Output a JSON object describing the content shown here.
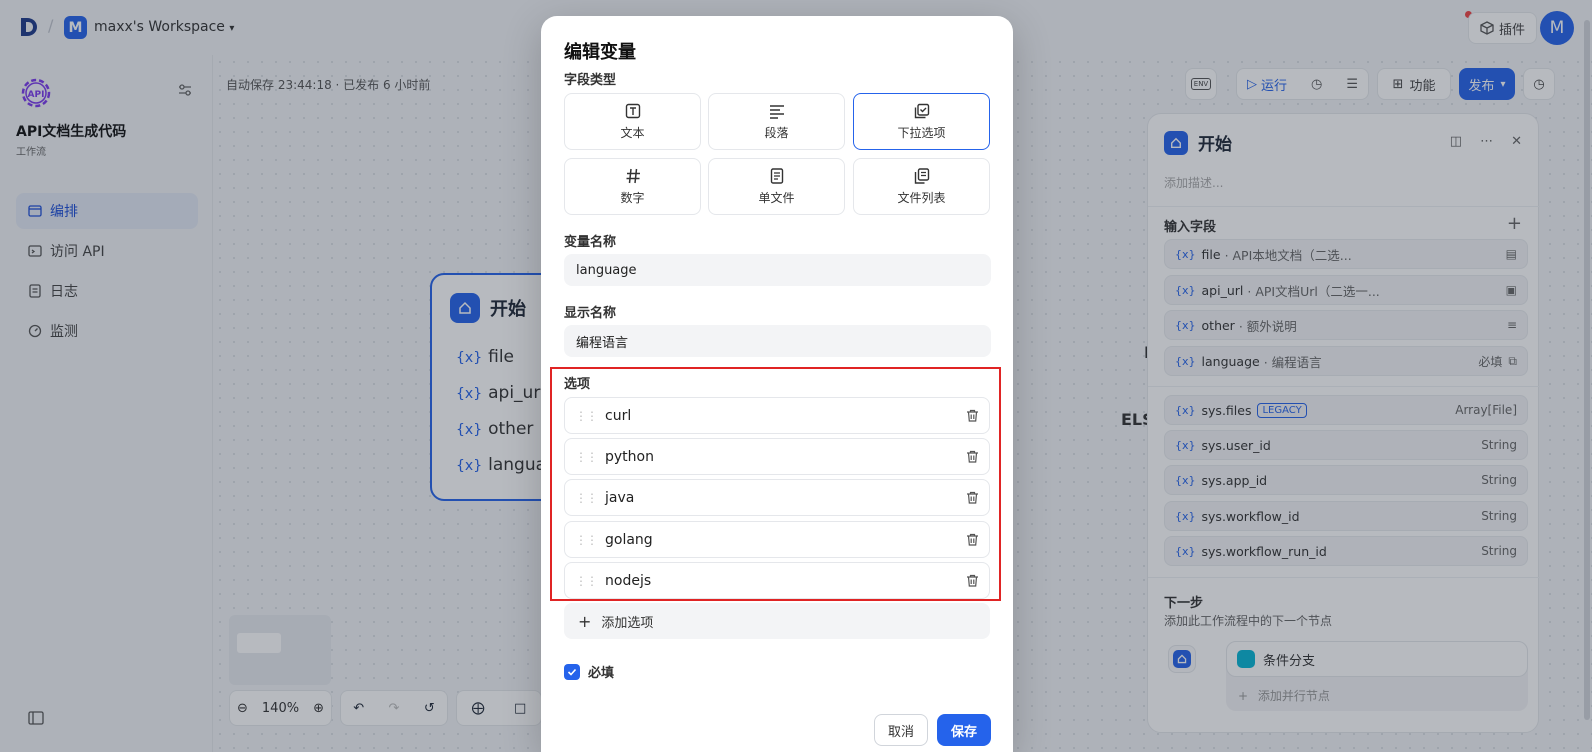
{
  "topbar": {
    "workspace_initial": "M",
    "workspace_name": "maxx's Workspace",
    "plugin_label": "插件",
    "user_initial": "M"
  },
  "sidebar": {
    "app_title": "API文档生成代码",
    "app_type": "工作流",
    "app_icon_text": "API",
    "items": [
      {
        "label": "编排",
        "active": true
      },
      {
        "label": "访问 API"
      },
      {
        "label": "日志"
      },
      {
        "label": "监测"
      }
    ]
  },
  "canvas": {
    "autosave": "自动保存 23:44:18 · 已发布 6 小时前",
    "node_title": "开始",
    "node_vars": [
      "file",
      "api_url",
      "other",
      "languag"
    ],
    "var_prefix": "{x}",
    "fragment_1": "I",
    "fragment_2": "ELS",
    "zoom": "140%"
  },
  "toolbar": {
    "env_label": "ENV",
    "run_label": "运行",
    "features_label": "功能",
    "publish_label": "发布"
  },
  "panel": {
    "title": "开始",
    "description_placeholder": "添加描述...",
    "input_fields_title": "输入字段",
    "fields": [
      {
        "name": "file",
        "desc": "· API本地文档（二选...",
        "right": ""
      },
      {
        "name": "api_url",
        "desc": "· API文档Url（二选一...",
        "right": ""
      },
      {
        "name": "other",
        "desc": "· 额外说明",
        "right": ""
      },
      {
        "name": "language",
        "desc": "· 编程语言",
        "right": "必填"
      }
    ],
    "system_fields": [
      {
        "name": "sys.files",
        "badge": "LEGACY",
        "type": "Array[File]"
      },
      {
        "name": "sys.user_id",
        "type": "String"
      },
      {
        "name": "sys.app_id",
        "type": "String"
      },
      {
        "name": "sys.workflow_id",
        "type": "String"
      },
      {
        "name": "sys.workflow_run_id",
        "type": "String"
      }
    ],
    "next_title": "下一步",
    "next_subtitle": "添加此工作流程中的下一个节点",
    "branch_label": "条件分支",
    "add_parallel": "添加并行节点"
  },
  "modal": {
    "title": "编辑变量",
    "field_type_label": "字段类型",
    "types": [
      {
        "label": "文本",
        "icon": "text-icon"
      },
      {
        "label": "段落",
        "icon": "paragraph-icon"
      },
      {
        "label": "下拉选项",
        "icon": "select-icon",
        "selected": true
      },
      {
        "label": "数字",
        "icon": "hash-icon"
      },
      {
        "label": "单文件",
        "icon": "file-icon"
      },
      {
        "label": "文件列表",
        "icon": "file-list-icon"
      }
    ],
    "var_name_label": "变量名称",
    "var_name_value": "language",
    "display_name_label": "显示名称",
    "display_name_value": "编程语言",
    "options_label": "选项",
    "options": [
      "curl",
      "python",
      "java",
      "golang",
      "nodejs"
    ],
    "add_option_label": "添加选项",
    "required_label": "必填",
    "required_checked": true,
    "cancel_label": "取消",
    "save_label": "保存",
    "accent_color": "#2563eb",
    "highlight_color": "#e02424"
  }
}
